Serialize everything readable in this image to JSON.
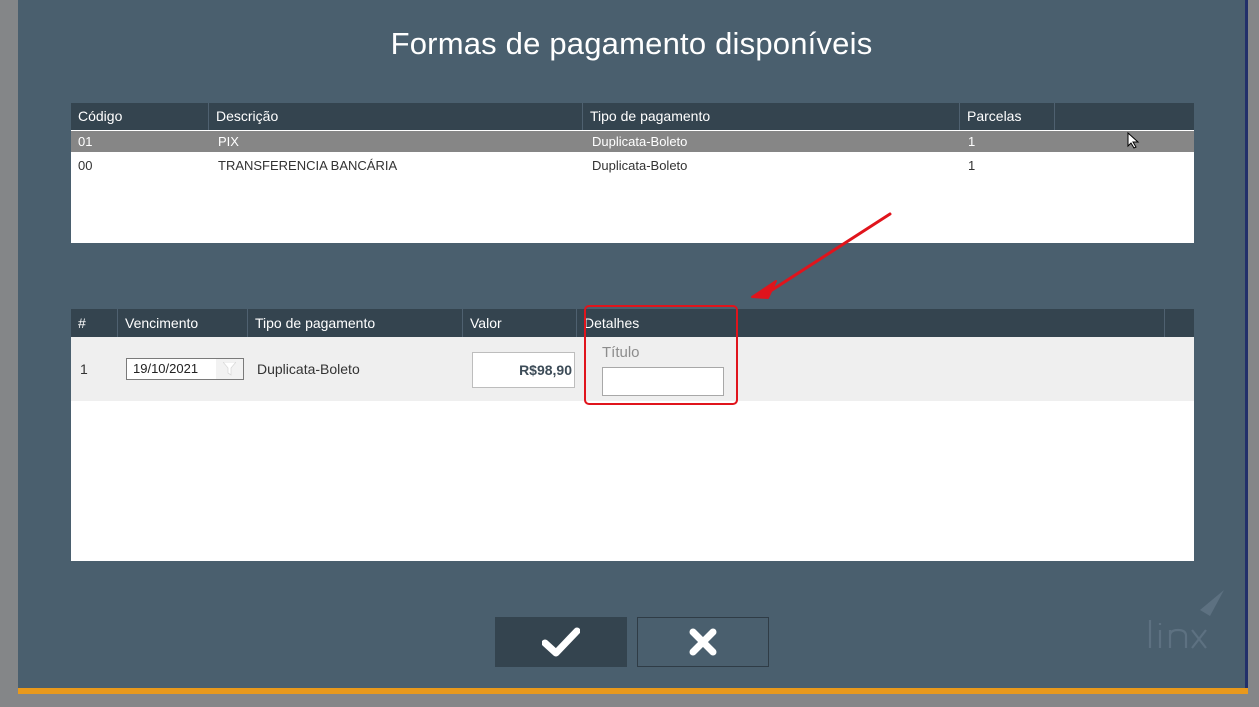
{
  "dialog": {
    "title": "Formas de pagamento disponíveis"
  },
  "payment_methods": {
    "columns": [
      "Código",
      "Descrição",
      "Tipo de pagamento",
      "Parcelas"
    ],
    "rows": [
      {
        "codigo": "01",
        "descricao": "PIX",
        "tipo": "Duplicata-Boleto",
        "parcelas": "1",
        "selected": true
      },
      {
        "codigo": "00",
        "descricao": "TRANSFERENCIA BANCÁRIA",
        "tipo": "Duplicata-Boleto",
        "parcelas": "1",
        "selected": false
      }
    ]
  },
  "installments": {
    "columns": [
      "#",
      "Vencimento",
      "Tipo de pagamento",
      "Valor",
      "Detalhes"
    ],
    "rows": [
      {
        "numero": "1",
        "vencimento": "19/10/2021",
        "tipo": "Duplicata-Boleto",
        "valor": "R$98,90",
        "detalhes_label": "Título",
        "titulo_value": ""
      }
    ]
  },
  "buttons": {
    "confirm_icon": "check-icon",
    "cancel_icon": "close-icon"
  },
  "brand": {
    "logo_icon": "linx-logo"
  },
  "colors": {
    "dialog_bg": "#4a5f6e",
    "header_bg": "#34444f",
    "selected_row": "#868686",
    "accent_bar": "#e8991c",
    "annotation_red": "#e0141c"
  }
}
